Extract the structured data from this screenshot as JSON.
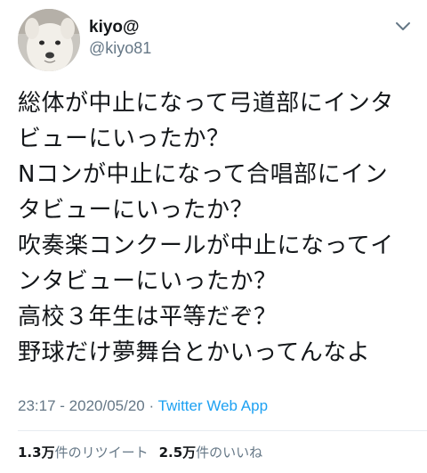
{
  "user": {
    "display_name": "kiyo@",
    "handle": "@kiyo81",
    "avatar_icon": "dog-avatar"
  },
  "tweet": {
    "lines": [
      "総体が中止になって弓道部にインタ",
      "ビューにいったか？",
      "Nコンが中止になって合唱部にイン",
      "タビューにいったか？",
      "吹奏楽コンクールが中止になってイ",
      "ンタビューにいったか？",
      "高校３年生は平等だぞ？",
      "野球だけ夢舞台とかいってんなよ"
    ]
  },
  "meta": {
    "time": "23:17",
    "date": "2020/05/20",
    "separator": " · ",
    "app": "Twitter Web App"
  },
  "stats": {
    "retweets_count": "1.3万",
    "retweets_label": "件のリツイート",
    "likes_count": "2.5万",
    "likes_label": "件のいいね"
  },
  "colors": {
    "text": "#14171a",
    "secondary": "#657786",
    "accent": "#1da1f2",
    "divider": "#e6ecf0"
  }
}
